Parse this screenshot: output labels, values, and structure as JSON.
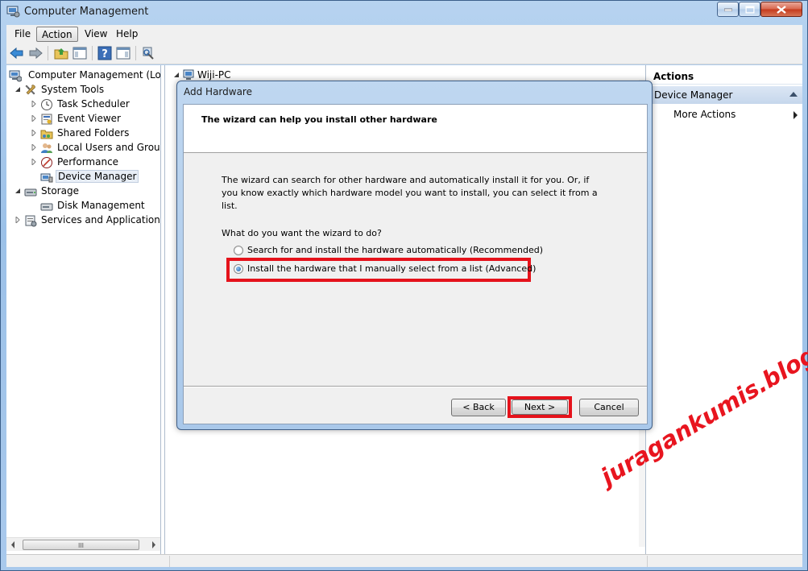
{
  "window": {
    "title": "Computer Management",
    "controls": {
      "minimize": "minimize-icon",
      "maximize": "maximize-icon",
      "close": "close-icon"
    }
  },
  "menu": [
    "File",
    "Action",
    "View",
    "Help"
  ],
  "toolbar": [
    "back-arrow-icon",
    "forward-arrow-icon",
    "up-folder-icon",
    "show-hide-tree-icon",
    "help-icon",
    "show-hide-action-pane-icon",
    "properties-icon"
  ],
  "tree": {
    "root": "Computer Management (Local",
    "system_tools": "System Tools",
    "items": [
      "Task Scheduler",
      "Event Viewer",
      "Shared Folders",
      "Local Users and Groups",
      "Performance",
      "Device Manager"
    ],
    "storage": "Storage",
    "disk_management": "Disk Management",
    "services": "Services and Applications",
    "scroll_grip": "III"
  },
  "center": {
    "root": "Wiji-PC"
  },
  "actions": {
    "title": "Actions",
    "section": "Device Manager",
    "more": "More Actions"
  },
  "dialog": {
    "title": "Add Hardware",
    "heading": "The wizard can help you install other hardware",
    "description": "The wizard can search for other hardware and automatically install it for you. Or, if you know exactly which hardware model you want to install, you can select it from a list.",
    "question": "What do you want the wizard to do?",
    "options": [
      {
        "label": "Search for and install the hardware automatically (Recommended)",
        "selected": false
      },
      {
        "label": "Install the hardware that I manually select from a list (Advanced)",
        "selected": true
      }
    ],
    "buttons": {
      "back": "< Back",
      "next": "Next >",
      "cancel": "Cancel"
    }
  },
  "highlight_color": "#e5121b",
  "watermark": "juragankumis.blogspot.com"
}
